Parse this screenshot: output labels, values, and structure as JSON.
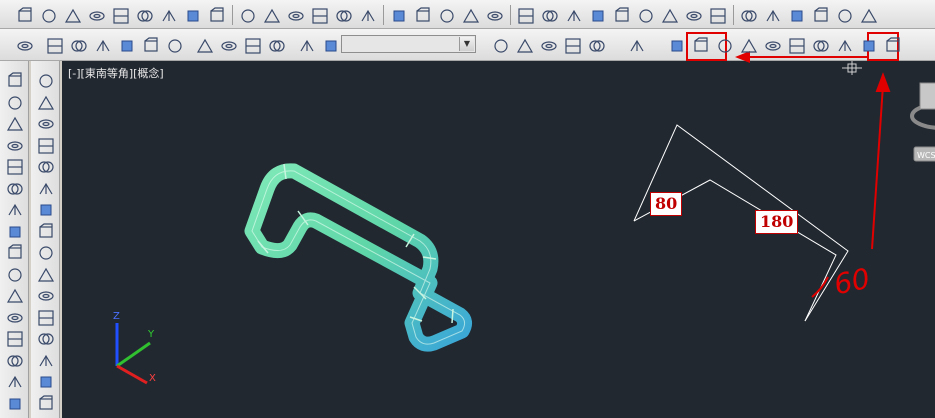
{
  "viewport": {
    "label": "[-][東南等角][概念]",
    "background": "#212830"
  },
  "annotations": {
    "dim_80": "80",
    "dim_180": "180",
    "handwritten_60": "60",
    "accent_color": "#e00000"
  },
  "ucs": {
    "x_label": "X",
    "y_label": "Y",
    "z_label": "Z"
  },
  "viewcube": {
    "wcs_label": "WCS"
  },
  "toolbars": {
    "row1_icons": [
      "polysolid-icon",
      "box-icon",
      "wedge-icon",
      "cone-icon",
      "sphere-icon",
      "cylinder-icon",
      "torus-icon",
      "pyramid-icon",
      "helix-icon",
      "planar-surface-icon",
      "extrude-icon",
      "presspull-icon",
      "sweep-icon",
      "revolve-icon",
      "loft-icon",
      "union-icon",
      "subtract-icon",
      "intersect-icon",
      "3d-move-icon",
      "3d-rotate-icon",
      "3d-align-icon",
      "3d-scale-icon",
      "slice-icon",
      "interfere-icon",
      "extract-edges-icon",
      "imprint-icon",
      "color-faces-icon",
      "copy-faces-icon",
      "color-edges-icon",
      "copy-edges-icon",
      "clean-icon",
      "separate-icon",
      "shell-icon",
      "check-icon",
      "ucs-icon"
    ],
    "row2_icons": [
      "regen-icon",
      "view-top-icon",
      "view-bottom-icon",
      "view-left-icon",
      "view-right-icon",
      "view-front-icon",
      "view-back-icon",
      "sw-iso-icon",
      "se-iso-icon",
      "ne-iso-icon",
      "nw-iso-icon",
      "camera-icon",
      "named-views-icon",
      "visual-style-2d-icon",
      "visual-style-hidden-icon",
      "visual-style-realistic-icon",
      "visual-style-conceptual-icon",
      "visual-style-manager-icon",
      "ucs-world-icon",
      "ucs-face-icon",
      "ucs-object-icon",
      "ucs-view-icon",
      "ucs-origin-icon",
      "ucs-zaxis-icon",
      "ucs-3point-icon",
      "ucs-x-icon",
      "ucs-y-icon",
      "ucs-z-icon",
      "ucs-apply-icon"
    ],
    "view_dropdown_value": ""
  }
}
